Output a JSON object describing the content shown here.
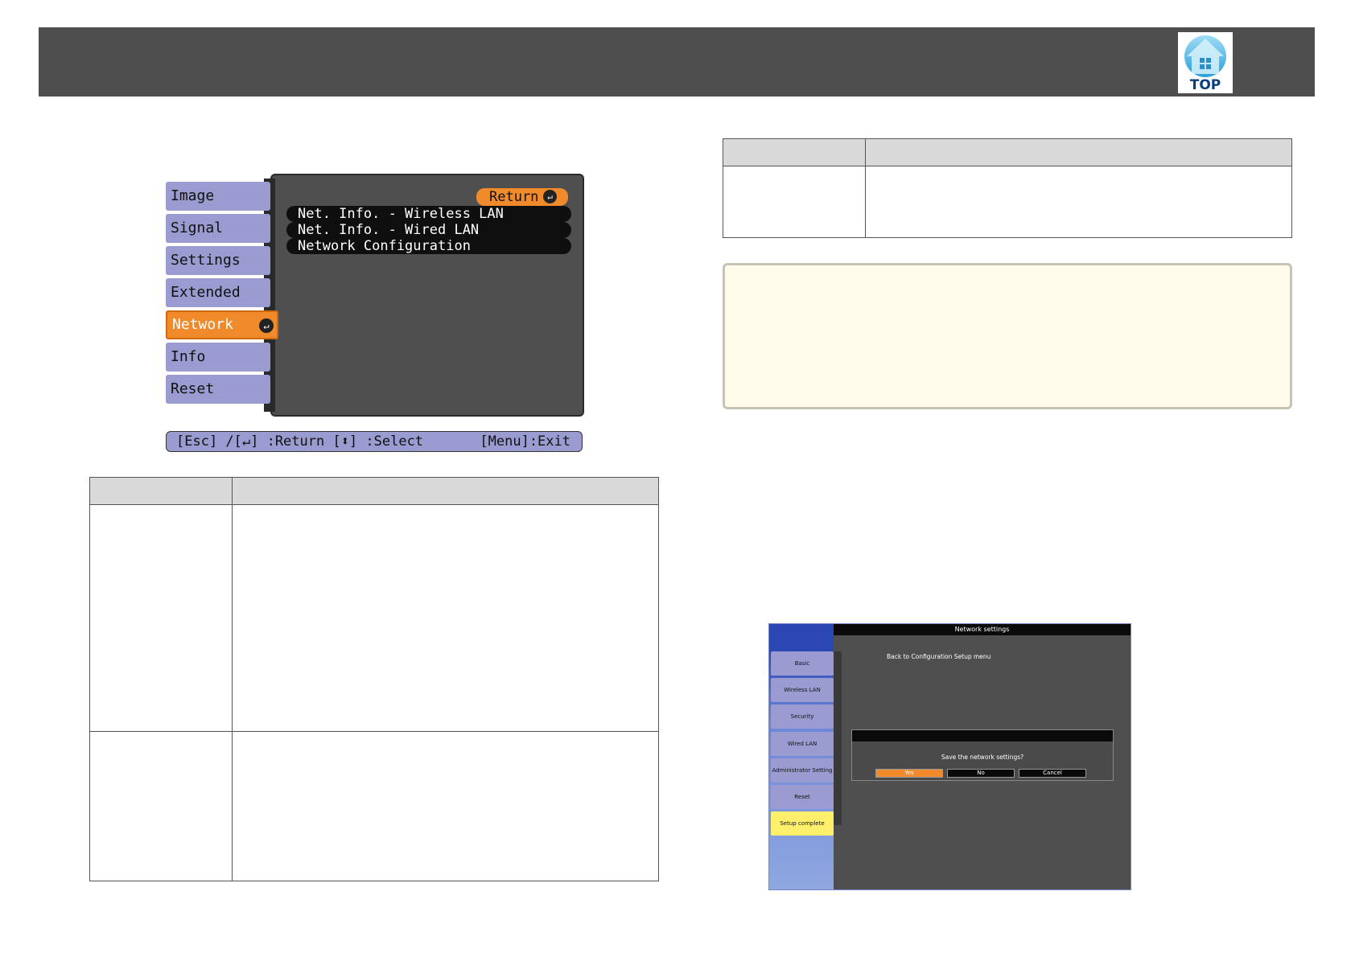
{
  "header": {
    "top_button": {
      "label": "TOP",
      "icon": "house-icon"
    }
  },
  "projector_menu": {
    "tabs": [
      {
        "label": "Image"
      },
      {
        "label": "Signal"
      },
      {
        "label": "Settings"
      },
      {
        "label": "Extended"
      },
      {
        "label": "Network",
        "active": true
      },
      {
        "label": "Info"
      },
      {
        "label": "Reset"
      }
    ],
    "return_label": "Return",
    "items": [
      "Net. Info. - Wireless LAN",
      "Net. Info. - Wired LAN",
      "Network Configuration"
    ],
    "footer_left": "[Esc] /[↵] :Return  [⬍] :Select",
    "footer_right": "[Menu]:Exit",
    "accent_color": "#f08a2a",
    "tab_color": "#9a9bd0"
  },
  "network_settings": {
    "title": "Network settings",
    "back_text": "Back to Configuration Setup menu",
    "tabs": [
      "Basic",
      "Wireless LAN",
      "Security",
      "Wired LAN",
      "Administrator Setting",
      "Reset",
      "Setup complete"
    ],
    "question": "Save the network settings?",
    "buttons": [
      "Yes",
      "No",
      "Cancel"
    ]
  }
}
